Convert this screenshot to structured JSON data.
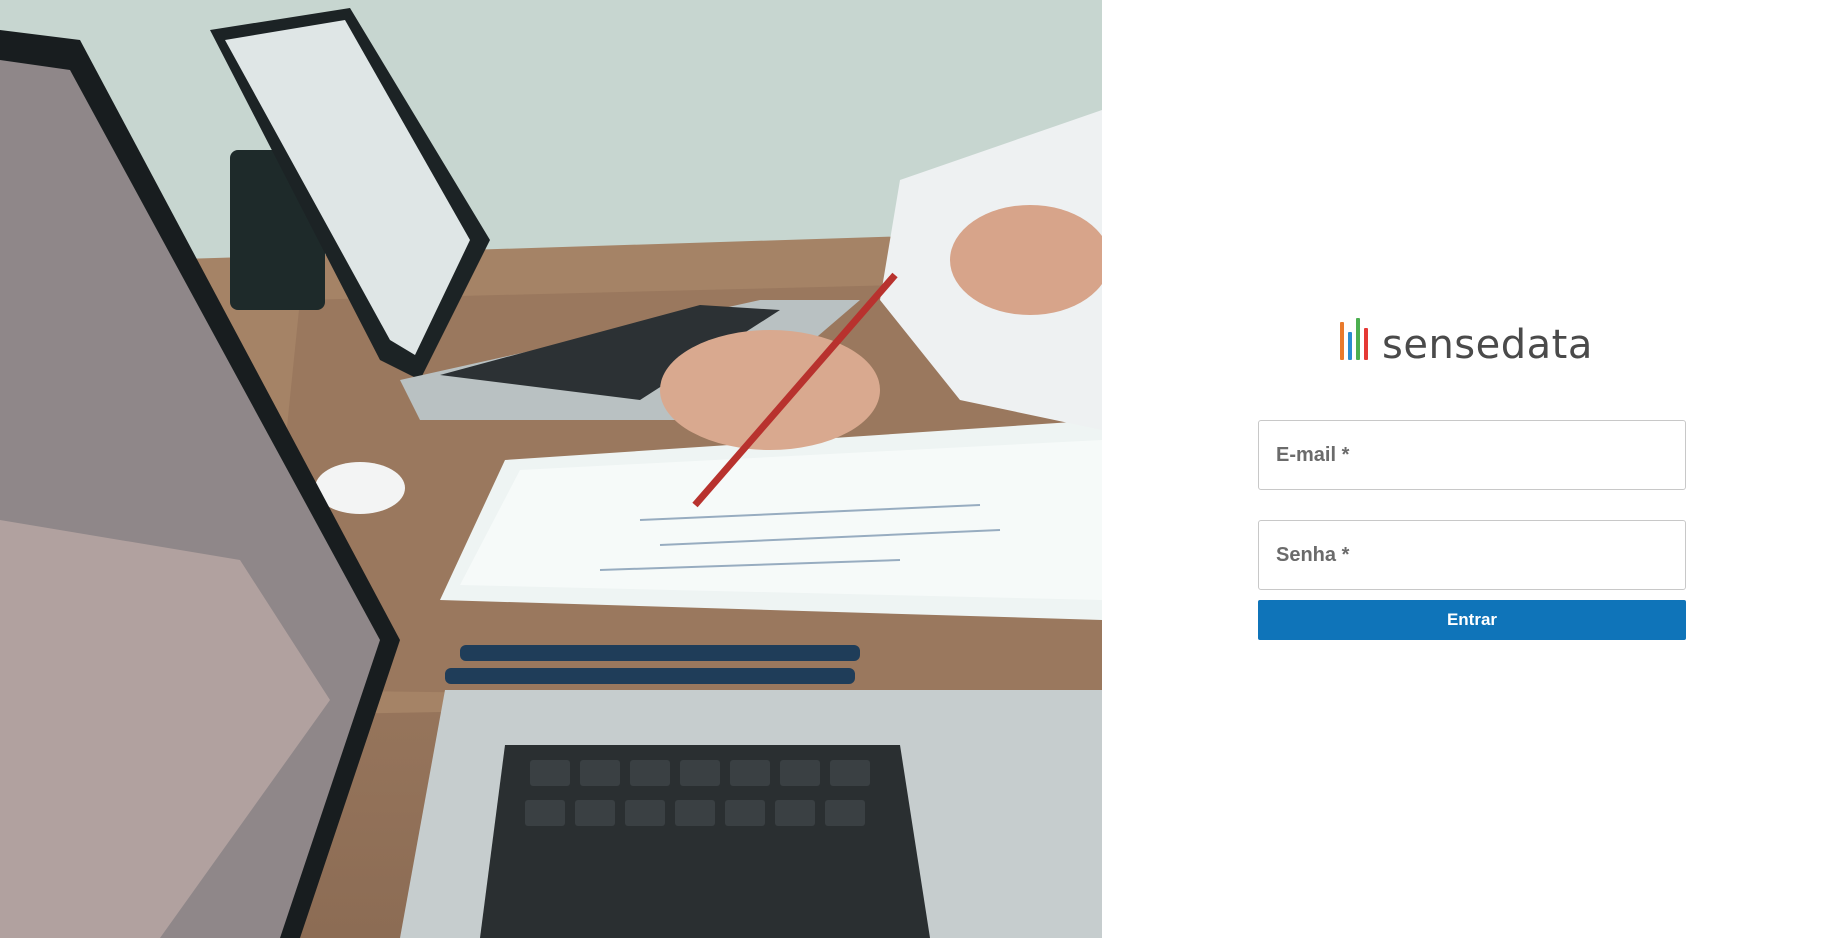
{
  "hero": {
    "description_icon": "photo-laptops-desk"
  },
  "logo": {
    "wordmark": "sensedata",
    "bar_colors": [
      "#e97a2c",
      "#2a8cd0",
      "#4caf50",
      "#e53935"
    ]
  },
  "form": {
    "email_label": "E-mail *",
    "password_label": "Senha *",
    "submit_label": "Entrar"
  },
  "colors": {
    "primary": "#0f74b9",
    "border": "#c8c8c8",
    "label": "#6b6b6b"
  }
}
